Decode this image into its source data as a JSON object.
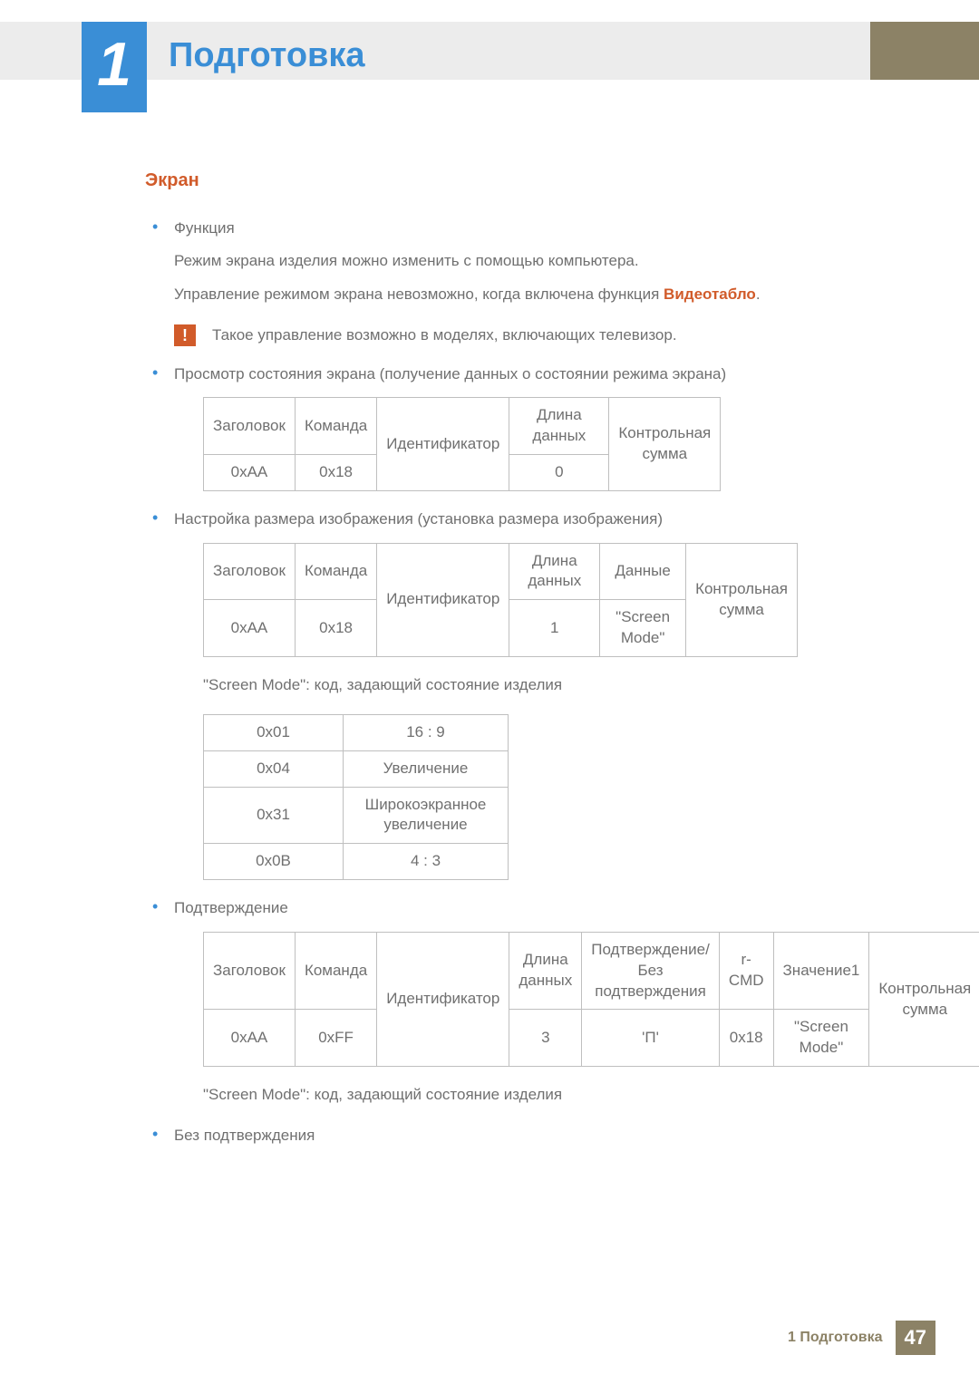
{
  "chapter": {
    "number": "1",
    "title": "Подготовка"
  },
  "section_title": "Экран",
  "blocks": {
    "func_label": "Функция",
    "func_line1": "Режим экрана изделия можно изменить с помощью компьютера.",
    "func_line2a": "Управление режимом экрана невозможно, когда включена функция ",
    "func_line2b": "Видеотабло",
    "func_line2c": ".",
    "note_icon": "!",
    "note_text": "Такое управление возможно в моделях, включающих телевизор.",
    "view_state": "Просмотр состояния экрана (получение данных о состоянии режима экрана)",
    "set_size": "Настройка размера изображения (установка размера изображения)",
    "screen_mode_desc": "\"Screen Mode\": код, задающий состояние изделия",
    "confirm": "Подтверждение",
    "no_confirm": "Без подтверждения"
  },
  "table1": {
    "h": [
      "Заголовок",
      "Команда",
      "Идентификатор",
      "Длина данных",
      "Контрольная сумма"
    ],
    "r": [
      "0xAA",
      "0x18",
      "",
      "0",
      ""
    ]
  },
  "table2": {
    "h": [
      "Заголовок",
      "Команда",
      "Идентификатор",
      "Длина данных",
      "Данные",
      "Контрольная сумма"
    ],
    "r": [
      "0xAA",
      "0x18",
      "",
      "1",
      "\"Screen Mode\"",
      ""
    ]
  },
  "table3": {
    "rows": [
      [
        "0x01",
        "16 : 9"
      ],
      [
        "0x04",
        "Увеличение"
      ],
      [
        "0x31",
        "Широкоэкранное увеличение"
      ],
      [
        "0x0B",
        "4 : 3"
      ]
    ]
  },
  "table4": {
    "h": [
      "Заголовок",
      "Команда",
      "Идентификатор",
      "Длина данных",
      "Подтверждение/Без подтверждения",
      "r-CMD",
      "Значение1",
      "Контрольная сумма"
    ],
    "r": [
      "0xAA",
      "0xFF",
      "",
      "3",
      "'П'",
      "0x18",
      "\"Screen Mode\"",
      ""
    ]
  },
  "footer": {
    "text": "1 Подготовка",
    "page": "47"
  }
}
